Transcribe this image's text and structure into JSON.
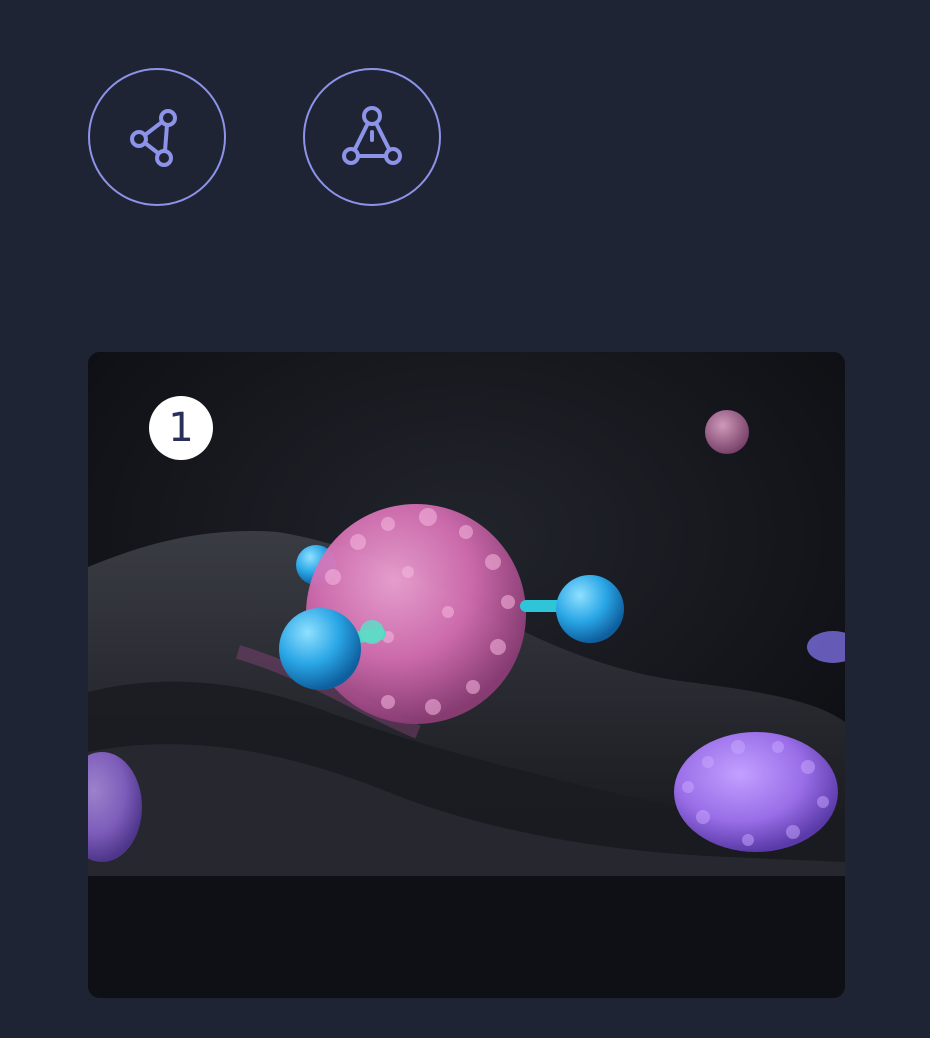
{
  "icons": [
    {
      "name": "share-network-icon"
    },
    {
      "name": "molecule-icon"
    }
  ],
  "feature_card": {
    "step_number": "1",
    "image_subject": "immune-cell-illustration"
  },
  "colors": {
    "background": "#1f2435",
    "icon_accent": "#8c93e8",
    "card_dark": "#0e1016",
    "cell_pink": "#d96fb5",
    "molecule_blue": "#2aa6e6",
    "cell_purple": "#9a6ee8"
  }
}
